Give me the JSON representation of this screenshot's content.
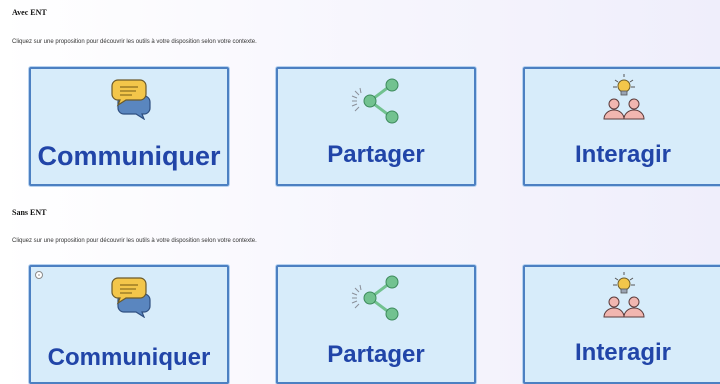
{
  "sections": [
    {
      "title": "Avec ENT",
      "description": "Cliquez sur une proposition pour découvrir les outils à votre disposition selon votre contexte.",
      "cards": [
        {
          "label": "Communiquer",
          "icon": "speech-bubbles-icon"
        },
        {
          "label": "Partager",
          "icon": "share-icon"
        },
        {
          "label": "Interagir",
          "icon": "people-idea-icon"
        }
      ]
    },
    {
      "title": "Sans ENT",
      "description": "Cliquez sur une proposition pour découvrir les outils à votre disposition selon votre contexte.",
      "cards": [
        {
          "label": "Communiquer",
          "icon": "speech-bubbles-icon"
        },
        {
          "label": "Partager",
          "icon": "share-icon"
        },
        {
          "label": "Interagir",
          "icon": "people-idea-icon"
        }
      ]
    }
  ],
  "colors": {
    "card_background": "#d7ecfa",
    "card_border": "#4c80c2",
    "label": "#2145a8",
    "share_icon": "#72c290",
    "bubble_yellow": "#f3c64a",
    "bubble_blue": "#5a86bf"
  }
}
